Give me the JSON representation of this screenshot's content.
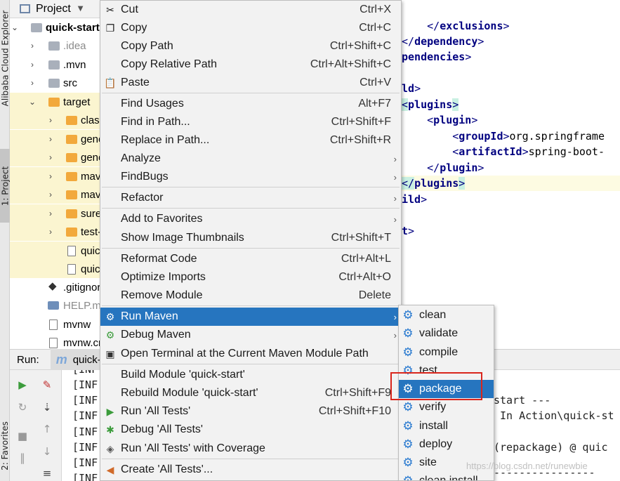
{
  "sidebar": {
    "alibaba_tab": "Alibaba Cloud Explorer",
    "project_tab": "1: Project",
    "favorites_tab": "2: Favorites"
  },
  "project_panel": {
    "title": "Project",
    "tree": [
      {
        "label": "quick-start",
        "bold": true
      },
      {
        "label": ".idea",
        "muted": true
      },
      {
        "label": ".mvn"
      },
      {
        "label": "src"
      },
      {
        "label": "target"
      },
      {
        "label": "classes"
      },
      {
        "label": "generated-sources"
      },
      {
        "label": "generated-test-sources"
      },
      {
        "label": "maven-archiver"
      },
      {
        "label": "maven-status"
      },
      {
        "label": "surefire-reports"
      },
      {
        "label": "test-classes"
      },
      {
        "label": "quick-start.jar"
      },
      {
        "label": "quick-start.jar.original"
      },
      {
        "label": ".gitignore"
      },
      {
        "label": "HELP.md",
        "muted": true
      },
      {
        "label": "mvnw"
      },
      {
        "label": "mvnw.cmd"
      }
    ]
  },
  "editor": {
    "lines": [
      {
        "indent": "    ",
        "open": "</",
        "tag": "exclusions",
        "close": ">"
      },
      {
        "indent": "",
        "open": "</",
        "tag": "dependency",
        "close": ">"
      },
      {
        "indent": "",
        "open": "",
        "tag": "pendencies",
        "close": ">"
      },
      {
        "indent": "",
        "open": "",
        "tag": "",
        "close": ""
      },
      {
        "indent": "",
        "open": "",
        "tag": "ld",
        "close": ">"
      },
      {
        "indent": "",
        "open": "<",
        "tag": "plugins",
        "close": ">"
      },
      {
        "indent": "    ",
        "open": "<",
        "tag": "plugin",
        "close": ">"
      },
      {
        "indent": "        ",
        "open": "<",
        "tag": "groupId",
        "close": ">",
        "text": "org.springframe"
      },
      {
        "indent": "        ",
        "open": "<",
        "tag": "artifactId",
        "close": ">",
        "text": "spring-boot-"
      },
      {
        "indent": "    ",
        "open": "</",
        "tag": "plugin",
        "close": ">"
      },
      {
        "indent": "",
        "open": "</",
        "tag": "plugins",
        "close": ">"
      },
      {
        "indent": "",
        "open": "",
        "tag": "ild",
        "close": ">"
      },
      {
        "indent": "",
        "open": "",
        "tag": "",
        "close": ""
      },
      {
        "indent": "",
        "open": "",
        "tag": "t",
        "close": ">"
      }
    ]
  },
  "run_panel": {
    "label": "Run:",
    "tab": "quick-start",
    "console_prefix": "[INF",
    "console_tails": [
      "start ---",
      "In Action\\quick-st",
      "(repackage) @ quic",
      "----------------"
    ]
  },
  "context_menu": {
    "items": [
      {
        "label": "Cut",
        "shortcut": "Ctrl+X",
        "icon": "scissors-icon"
      },
      {
        "label": "Copy",
        "shortcut": "Ctrl+C",
        "icon": "copy-icon"
      },
      {
        "label": "Copy Path",
        "shortcut": "Ctrl+Shift+C"
      },
      {
        "label": "Copy Relative Path",
        "shortcut": "Ctrl+Alt+Shift+C"
      },
      {
        "label": "Paste",
        "shortcut": "Ctrl+V",
        "icon": "paste-icon"
      },
      {
        "label": "Find Usages",
        "shortcut": "Alt+F7"
      },
      {
        "label": "Find in Path...",
        "shortcut": "Ctrl+Shift+F"
      },
      {
        "label": "Replace in Path...",
        "shortcut": "Ctrl+Shift+R"
      },
      {
        "label": "Analyze",
        "submenu": true
      },
      {
        "label": "FindBugs",
        "submenu": true
      },
      {
        "label": "Refactor",
        "submenu": true
      },
      {
        "label": "Add to Favorites",
        "submenu": true
      },
      {
        "label": "Show Image Thumbnails",
        "shortcut": "Ctrl+Shift+T"
      },
      {
        "label": "Reformat Code",
        "shortcut": "Ctrl+Alt+L"
      },
      {
        "label": "Optimize Imports",
        "shortcut": "Ctrl+Alt+O"
      },
      {
        "label": "Remove Module",
        "shortcut": "Delete"
      },
      {
        "label": "Run Maven",
        "submenu": true,
        "selected": true,
        "icon": "maven-gear-icon"
      },
      {
        "label": "Debug Maven",
        "submenu": true,
        "icon": "debug-maven-icon"
      },
      {
        "label": "Open Terminal at the Current Maven Module Path",
        "icon": "terminal-icon"
      },
      {
        "label": "Build Module 'quick-start'"
      },
      {
        "label": "Rebuild Module 'quick-start'",
        "shortcut": "Ctrl+Shift+F9"
      },
      {
        "label": "Run 'All Tests'",
        "shortcut": "Ctrl+Shift+F10",
        "icon": "run-icon"
      },
      {
        "label": "Debug 'All Tests'",
        "icon": "debug-icon"
      },
      {
        "label": "Run 'All Tests' with Coverage",
        "icon": "coverage-icon"
      },
      {
        "label": "Create 'All Tests'...",
        "icon": "create-config-icon"
      }
    ]
  },
  "maven_submenu": {
    "items": [
      {
        "label": "clean"
      },
      {
        "label": "validate"
      },
      {
        "label": "compile"
      },
      {
        "label": "test"
      },
      {
        "label": "package",
        "selected": true
      },
      {
        "label": "verify"
      },
      {
        "label": "install"
      },
      {
        "label": "deploy"
      },
      {
        "label": "site"
      },
      {
        "label": "clean install"
      }
    ]
  },
  "watermark": "https://blog.csdn.net/runewbie",
  "colors": {
    "selection": "#2675bf",
    "menu_bg": "#f2f2f2",
    "xml_tag": "#000080",
    "highlight_box": "#d9261c",
    "maven_gear": "#2b7bd0"
  }
}
